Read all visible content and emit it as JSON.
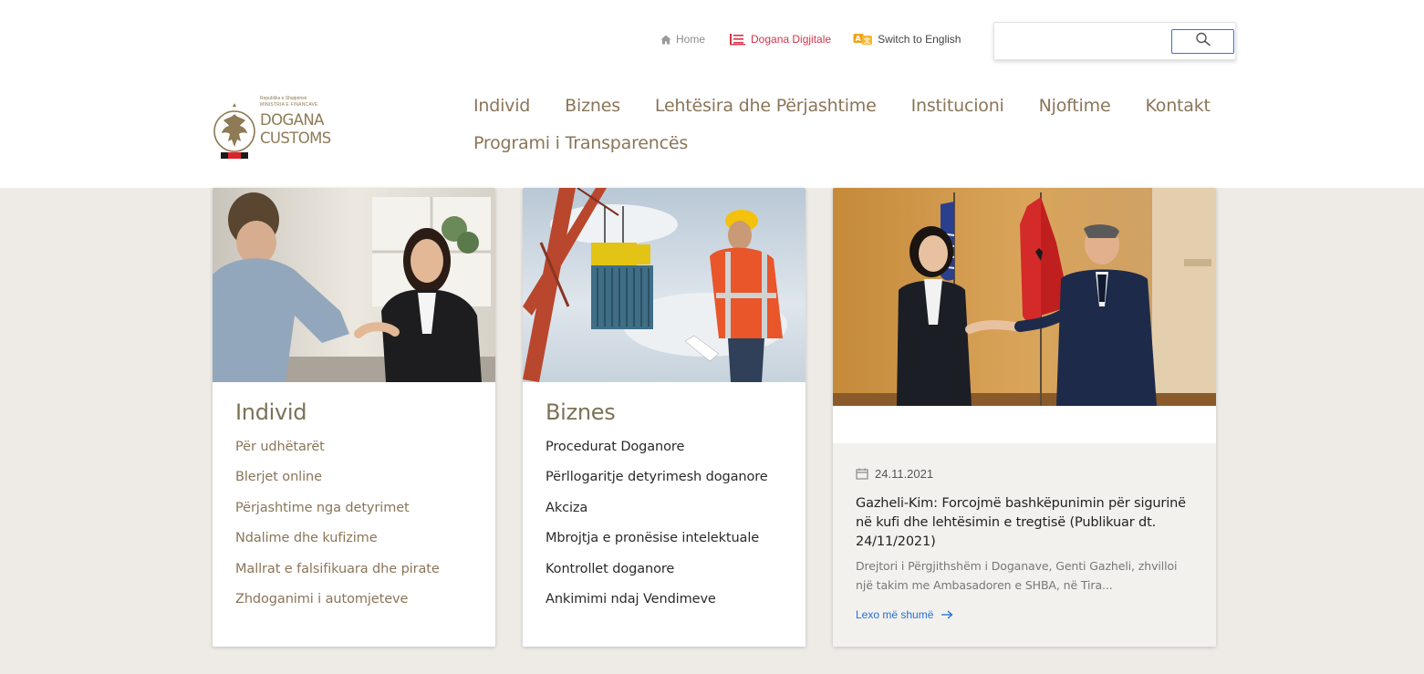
{
  "top_links": {
    "home": "Home",
    "digital": "Dogana Digjitale",
    "english": "Switch to English"
  },
  "search": {
    "placeholder": "",
    "value": ""
  },
  "logo": {
    "line1": "Republika e Shqipërisë",
    "line2": "MINISTRIA E FINANCAVE",
    "line3": "DOGANA",
    "line4": "CUSTOMS"
  },
  "nav": {
    "row1": [
      "Individ",
      "Biznes",
      "Lehtësira dhe Përjashtime",
      "Institucioni",
      "Njoftime",
      "Kontakt"
    ],
    "row2": [
      "Programi i Transparencës"
    ]
  },
  "cards": {
    "individ": {
      "title": "Individ",
      "items": [
        "Për udhëtarët",
        "Blerjet online",
        "Përjashtime nga detyrimet",
        "Ndalime dhe kufizime",
        "Mallrat e falsifikuara dhe pirate",
        "Zhdoganimi i automjeteve"
      ]
    },
    "biznes": {
      "title": "Biznes",
      "items": [
        "Procedurat Doganore",
        "Përllogaritje detyrimesh doganore",
        "Akciza",
        "Mbrojtja e pronësise intelektuale",
        "Kontrollet doganore",
        "Ankimimi ndaj Vendimeve"
      ]
    }
  },
  "news": {
    "date": "24.11.2021",
    "title": "Gazheli-Kim: Forcojmë bashkëpunimin për sigurinë në kufi dhe lehtësimin e tregtisë (Publikuar dt. 24/11/2021)",
    "excerpt": "Drejtori i Përgjithshëm i Doganave, Genti Gazheli, zhvilloi një takim me Ambasadoren e SHBA, në Tira...",
    "read_more": "Lexo më shumë"
  },
  "colors": {
    "accent_gold": "#8a7558",
    "link_red": "#d5344a",
    "link_blue": "#1f6fd6",
    "background": "#eeebe6"
  }
}
